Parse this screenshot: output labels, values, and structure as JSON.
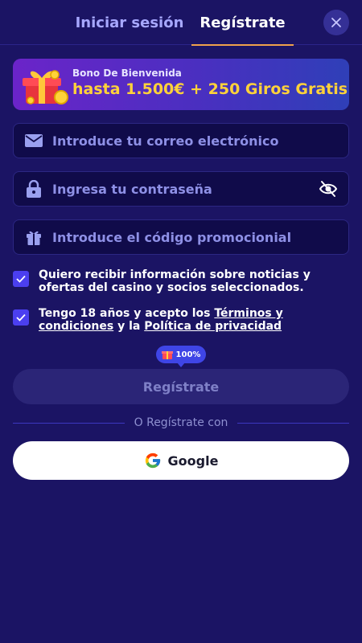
{
  "tabs": {
    "login_label": "Iniciar sesión",
    "register_label": "Regístrate",
    "active": "register"
  },
  "bonus": {
    "subtitle": "Bono De Bienvenida",
    "title": "hasta 1.500€ + 250 Giros Gratis"
  },
  "form": {
    "email_placeholder": "Introduce tu correo electrónico",
    "password_placeholder": "Ingresa tu contraseña",
    "promo_placeholder": "Introduce el código promocionial"
  },
  "consents": {
    "newsletter_text": "Quiero recibir información sobre noticias y ofertas del casino y socios seleccionados.",
    "newsletter_checked": true,
    "age_text_prefix": "Tengo 18 años y acepto los ",
    "terms_link": "Términos y condiciones",
    "age_text_middle": " y la ",
    "privacy_link": "Política de privacidad",
    "age_checked": true
  },
  "progress": {
    "label": "100%",
    "value": 1.0
  },
  "submit": {
    "label": "Regístrate"
  },
  "social": {
    "divider_text": "O Regístrate con",
    "google_label": "Google"
  },
  "colors": {
    "background": "#1b1464",
    "accent": "#f0a14c",
    "bonus_text": "#ffd23a",
    "checkbox": "#4b3ff0"
  },
  "icons": {
    "close": "close-icon",
    "email": "envelope-icon",
    "password": "lock-icon",
    "visibility": "eye-slash-icon",
    "promo": "gift-icon",
    "google": "google-icon"
  }
}
